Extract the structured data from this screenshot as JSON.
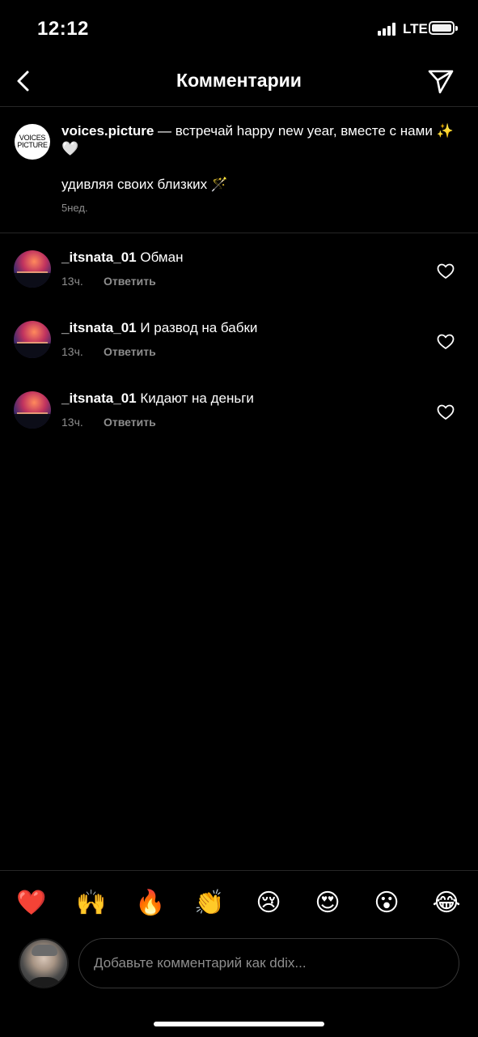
{
  "status_bar": {
    "time": "12:12",
    "network": "LTE"
  },
  "header": {
    "title": "Комментарии"
  },
  "caption": {
    "avatar_line1": "VOICES",
    "avatar_line2": "PICTURE",
    "username": "voices.picture",
    "text": " — встречай happy new year, вместе с нами ✨🤍",
    "text_line2": "удивляя своих близких 🪄",
    "time": "5нед."
  },
  "comments": [
    {
      "username": "_itsnata_01",
      "text": " Обман",
      "time": "13ч.",
      "reply": "Ответить"
    },
    {
      "username": "_itsnata_01",
      "text": " И развод на бабки",
      "time": "13ч.",
      "reply": "Ответить"
    },
    {
      "username": "_itsnata_01",
      "text": " Кидают на деньги",
      "time": "13ч.",
      "reply": "Ответить"
    }
  ],
  "emoji_bar": [
    "❤️",
    "🙌",
    "🔥",
    "👏",
    "😢",
    "😍",
    "😮",
    "😂"
  ],
  "input": {
    "placeholder": "Добавьте комментарий как ddix..."
  },
  "colors": {
    "background": "#000000",
    "muted_text": "#8e8e8e",
    "divider": "#262626"
  }
}
